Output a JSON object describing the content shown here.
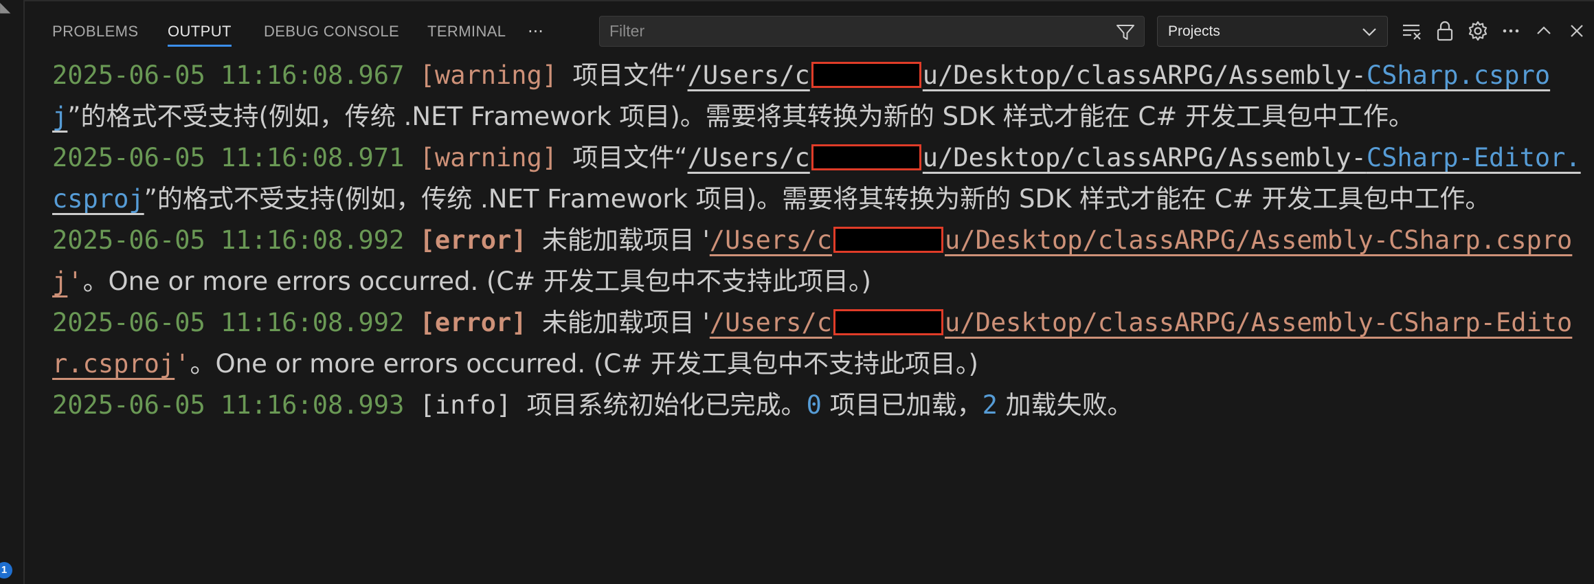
{
  "panel": {
    "tabs": [
      {
        "label": "PROBLEMS",
        "active": false
      },
      {
        "label": "OUTPUT",
        "active": true
      },
      {
        "label": "DEBUG CONSOLE",
        "active": false
      },
      {
        "label": "TERMINAL",
        "active": false
      }
    ],
    "more_tabs": "···",
    "filter_placeholder": "Filter",
    "channel_select": "Projects",
    "badge_count": "1",
    "icons": [
      "filter-icon",
      "chevron-down-icon",
      "clear-output-icon",
      "lock-icon",
      "gear-icon",
      "more-actions-icon",
      "maximize-panel-icon",
      "close-panel-icon"
    ],
    "colors": {
      "timestamp": "#6a9955",
      "error": "#ce9178",
      "link": "#569cd6",
      "active_tab_underline": "#3b8eea"
    }
  },
  "log": [
    {
      "timestamp": "2025-06-05 11:16:08.967",
      "level": "[warning]",
      "prefix": "项目文件“",
      "path_a": "/Users/c",
      "path_b": "u/Desktop/classARPG/Assembly-",
      "path_hl": "CSharp.csproj",
      "suffix": "”的格式不受支持(例如，传统 .NET Framework 项目)。需要将其转换为新的 SDK 样式才能在 C# 开发工具包中工作。"
    },
    {
      "timestamp": "2025-06-05 11:16:08.971",
      "level": "[warning]",
      "prefix": "项目文件“",
      "path_a": "/Users/c",
      "path_b": "u/Desktop/classARPG/Assembly-",
      "path_hl": "CSharp-Editor.csproj",
      "suffix": "”的格式不受支持(例如，传统 .NET Framework 项目)。需要将其转换为新的 SDK 样式才能在 C# 开发工具包中工作。"
    },
    {
      "timestamp": "2025-06-05 11:16:08.992",
      "level": "[error]",
      "prefix": "未能加载项目 '",
      "path_a": "/Users/c",
      "path_b": "u/Desktop/classARPG/Assembly-CSharp.csproj",
      "suffix_quote": "'",
      "suffix": "。One or more errors occurred. (C# 开发工具包中不支持此项目。)"
    },
    {
      "timestamp": "2025-06-05 11:16:08.992",
      "level": "[error]",
      "prefix": "未能加载项目 '",
      "path_a": "/Users/c",
      "path_b": "u/Desktop/classARPG/Assembly-CSharp-Editor.csproj",
      "suffix_quote": "'",
      "suffix": "。One or more errors occurred. (C# 开发工具包中不支持此项目。)"
    },
    {
      "timestamp": "2025-06-05 11:16:08.993",
      "level": "[info]",
      "text_a": "项目系统初始化已完成。",
      "loaded_count": "0",
      "text_b": " 项目已加载，",
      "failed_count": "2",
      "text_c": " 加载失败。"
    }
  ]
}
